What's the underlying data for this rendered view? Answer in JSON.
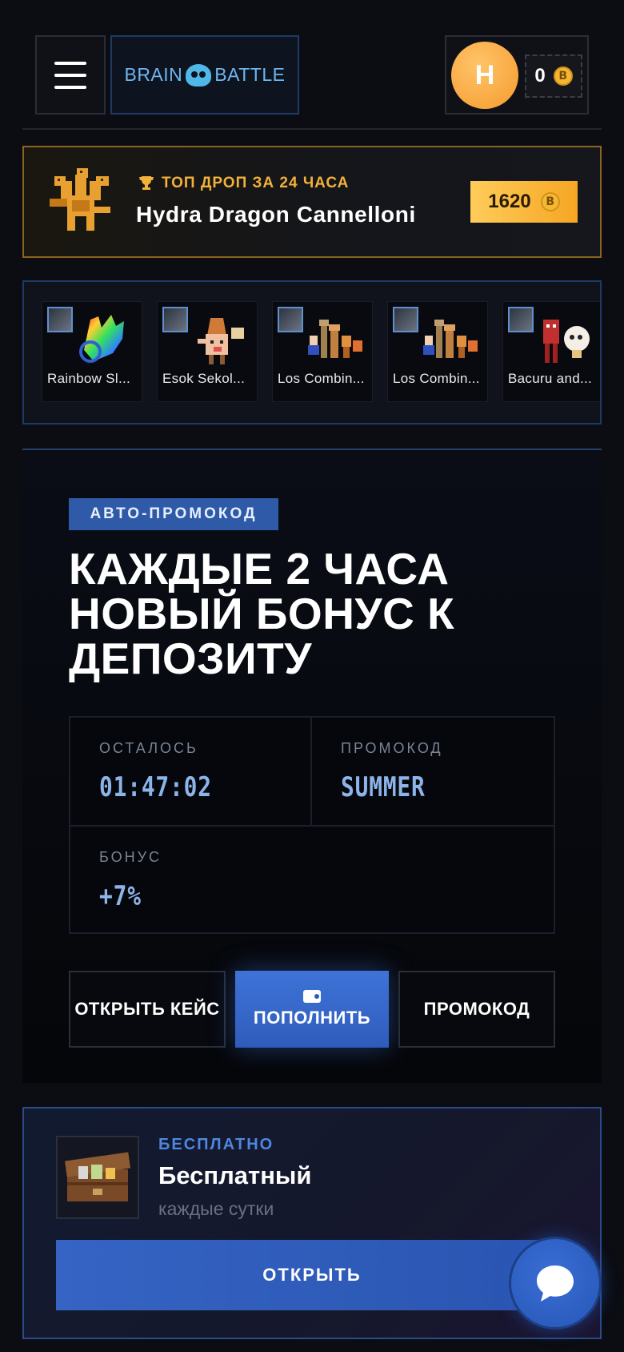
{
  "header": {
    "logo_left": "BRAIN",
    "logo_right": "BATTLE",
    "avatar_letter": "H",
    "balance": "0",
    "coin_symbol": "B"
  },
  "top_drop": {
    "label": "ТОП ДРОП ЗА 24 ЧАСА",
    "item_name": "Hydra Dragon Cannelloni",
    "price": "1620"
  },
  "recent_drops": [
    {
      "name": "Rainbow Sl..."
    },
    {
      "name": "Esok Sekol..."
    },
    {
      "name": "Los Combin..."
    },
    {
      "name": "Los Combin..."
    },
    {
      "name": "Bacuru and..."
    }
  ],
  "promo": {
    "tag": "АВТО-ПРОМОКОД",
    "title": "КАЖДЫЕ 2 ЧАСА НОВЫЙ БОНУС К ДЕПОЗИТУ",
    "remaining_label": "ОСТАЛОСЬ",
    "remaining_value": "01:47:02",
    "code_label": "ПРОМОКОД",
    "code_value": "SUMMER",
    "bonus_label": "БОНУС",
    "bonus_value": "+7%",
    "open_case": "ОТКРЫТЬ КЕЙС",
    "deposit": "ПОПОЛНИТЬ",
    "promo_button": "ПРОМОКОД"
  },
  "free_case": {
    "label": "БЕСПЛАТНО",
    "title": "Бесплатный",
    "subtitle": "каждые сутки",
    "open_button": "ОТКРЫТЬ"
  },
  "colors": {
    "accent_blue": "#3564c4",
    "gold": "#f5a623",
    "code_value": "#8cb4e8"
  }
}
